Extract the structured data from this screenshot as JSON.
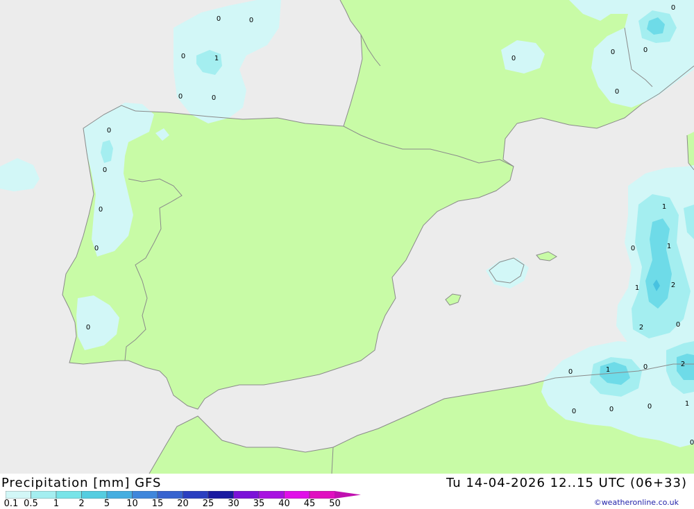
{
  "title": "Precipitation [mm] GFS",
  "datetime": "Tu 14-04-2026 12..15 UTC (06+33)",
  "credit": "©weatheronline.co.uk",
  "colors": {
    "sea": "#ececec",
    "land": "#c8fba6",
    "coast": "#8a8a8a",
    "precip_light": "#d2f7f7",
    "precip_mid": "#a4eef0",
    "precip_strong": "#6edbe8",
    "precip_core": "#48c2e0"
  },
  "legend": {
    "labels": [
      "0.1",
      "0.5",
      "1",
      "2",
      "5",
      "10",
      "15",
      "20",
      "25",
      "30",
      "35",
      "40",
      "45",
      "50"
    ],
    "colors": [
      "#d2f7f7",
      "#a4eef0",
      "#78e4e8",
      "#55cde0",
      "#45aee0",
      "#3f86db",
      "#3763cf",
      "#2a3fc0",
      "#1a1aa0",
      "#7b12d8",
      "#a812e0",
      "#e010e8",
      "#e010c0",
      "#c010b0"
    ]
  },
  "values": [
    "0",
    "0",
    "0",
    "1",
    "0",
    "0",
    "0",
    "0",
    "0",
    "0",
    "0",
    "0",
    "0",
    "0",
    "0",
    "0",
    "1",
    "1",
    "0",
    "1",
    "2",
    "2",
    "0",
    "0",
    "1",
    "0",
    "2",
    "0",
    "0",
    "0",
    "1",
    "0"
  ]
}
